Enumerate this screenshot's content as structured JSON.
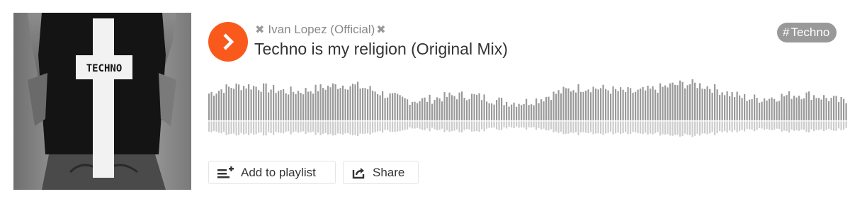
{
  "track": {
    "artist": "Ivan Lopez (Official)",
    "title": "Techno is my religion (Original Mix)",
    "tag_hash": "#",
    "tag": "Techno"
  },
  "artwork": {
    "shirt_text": "TECHNO"
  },
  "actions": {
    "add_to_playlist": "Add to playlist",
    "share": "Share"
  },
  "icons": {
    "play": "play-icon",
    "artist_mark": "cross-icon",
    "playlist": "add-to-playlist-icon",
    "share": "share-icon"
  },
  "colors": {
    "accent": "#f95a1c",
    "waveform": "#999999",
    "waveform_reflection": "#cccccc",
    "tag_bg": "#999999"
  }
}
